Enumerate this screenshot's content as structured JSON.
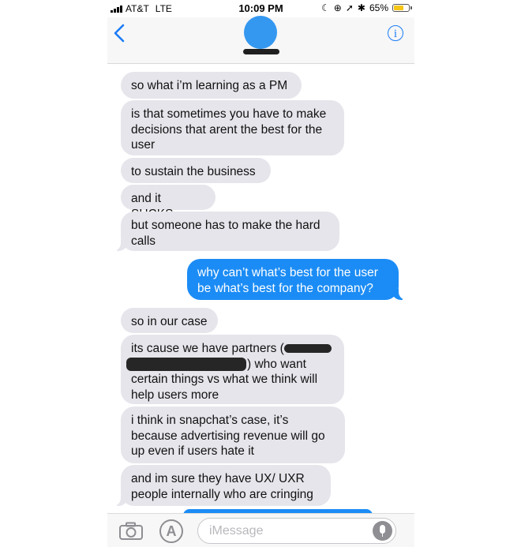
{
  "status_bar": {
    "carrier": "AT&T",
    "network": "LTE",
    "time": "10:09 PM",
    "battery": "65%",
    "battery_level": 0.65
  },
  "header": {
    "back_icon": "chevron-left-icon",
    "info_icon": "info-icon",
    "info_glyph": "i"
  },
  "messages": [
    {
      "side": "received",
      "text": "so what i’m learning as a PM"
    },
    {
      "side": "received",
      "text": "is that sometimes you have to make decisions that arent the best for the user"
    },
    {
      "side": "received",
      "text": "to sustain the business"
    },
    {
      "side": "received",
      "text": "and it SUCKS"
    },
    {
      "side": "received",
      "text": "but someone has to make the hard calls"
    },
    {
      "side": "sent",
      "text": "why can’t what’s best for the user be what’s best for the company?"
    },
    {
      "side": "received",
      "text": "so in our case"
    },
    {
      "side": "received",
      "text_before": "its cause we have partners (",
      "text_after": ") who want certain things vs what we think will help users more"
    },
    {
      "side": "received",
      "text": "i think in snapchat’s case, it’s because advertising revenue will go up even if users hate it"
    },
    {
      "side": "received",
      "text": "and im sure they have UX/ UXR people internally who are cringing"
    }
  ],
  "input_bar": {
    "placeholder": "iMessage",
    "camera_icon": "camera-icon",
    "app_store_icon": "app-store-icon",
    "mic_icon": "microphone-icon"
  }
}
